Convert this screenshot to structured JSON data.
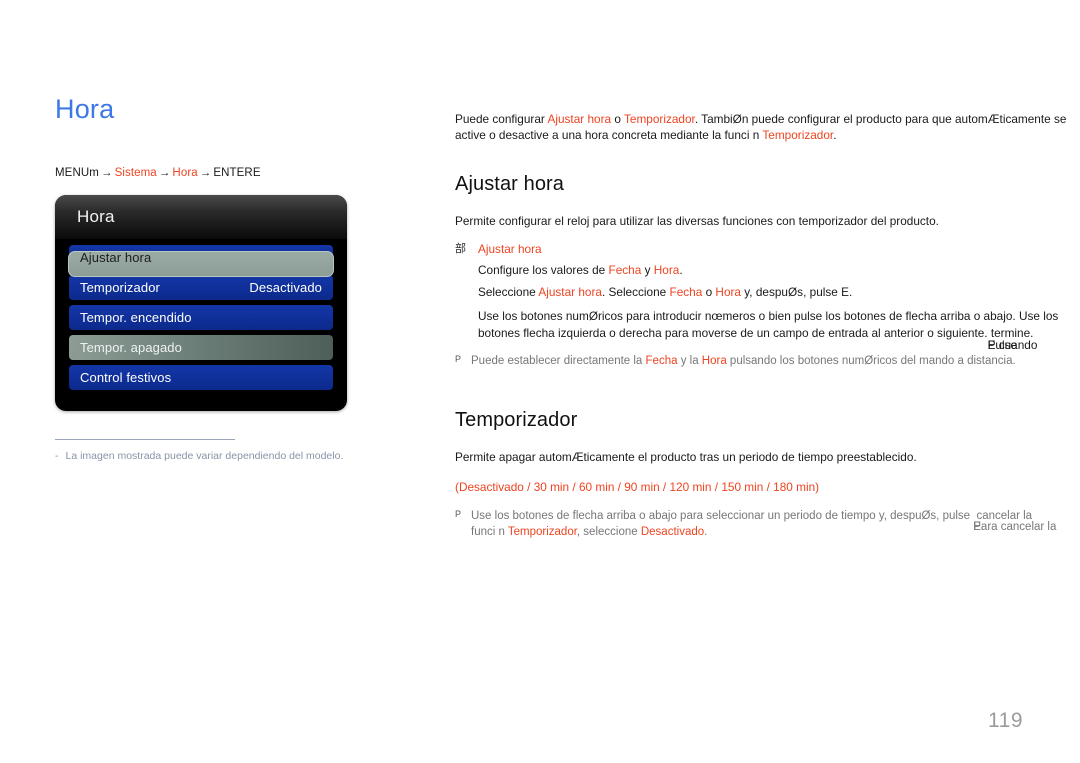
{
  "page": {
    "title": "Hora",
    "number": "119"
  },
  "breadcrumb": {
    "start": "MENUm",
    "arrow": "→",
    "item1": "Sistema",
    "item2": "Hora",
    "end": "ENTERE"
  },
  "osd": {
    "header_title": "Hora",
    "items": [
      {
        "label": "Ajustar hora",
        "value": "",
        "state": "selected"
      },
      {
        "label": "Temporizador",
        "value": "Desactivado",
        "state": "normal"
      },
      {
        "label": "Tempor. encendido",
        "value": "",
        "state": "normal"
      },
      {
        "label": "Tempor. apagado",
        "value": "",
        "state": "dim"
      },
      {
        "label": "Control festivos",
        "value": "",
        "state": "normal"
      }
    ]
  },
  "footnote": {
    "dash": "-",
    "text": "La imagen mostrada puede variar dependiendo del modelo."
  },
  "intro": {
    "p1_a": "Puede configurar ",
    "p1_link1": "Ajustar hora",
    "p1_b": " o ",
    "p1_link2": "Temporizador",
    "p1_c": ". TambiØn puede configurar el producto para que automÆticamente se active o desactive a una hora concreta mediante la funci n ",
    "p1_link3": "Temporizador",
    "p1_d": "."
  },
  "ajustar": {
    "heading": "Ajustar hora",
    "intro": "Permite configurar el reloj para utilizar las diversas funciones con temporizador del producto.",
    "bullet_glyph": "部",
    "bullet_title": "Ajustar hora",
    "line1_a": "Configure los valores de ",
    "line1_link1": "Fecha",
    "line1_b": " y ",
    "line1_link2": "Hora",
    "line1_c": ".",
    "line2_a": "Seleccione ",
    "line2_link1": "Ajustar hora",
    "line2_b": ". Seleccione ",
    "line2_link2": "Fecha",
    "line2_c": " o ",
    "line2_link3": "Hora",
    "line2_d": " y, despuØs, pulse E.",
    "line3": "Use los botones numØricos para introducir nœmeros o bien pulse los botones de flecha arriba o abajo. Use los botones flecha izquierda o derecha para moverse de un campo de entrada al anterior o siguiente.",
    "line3_overlap_a": "Pulse",
    "line3_overlap_b": "E cuando",
    "line3_tail": " termine.",
    "note_marker": "P",
    "note_a": "Puede establecer directamente la ",
    "note_link1": "Fecha",
    "note_b": " y la ",
    "note_link2": "Hora",
    "note_c": " pulsando los botones numØricos del mando a distancia."
  },
  "temporizador": {
    "heading": "Temporizador",
    "intro": "Permite apagar automÆticamente el producto tras un periodo de tiempo preestablecido.",
    "options_open": "(",
    "options": [
      "Desactivado",
      "30 min",
      "60 min",
      "90 min",
      "120 min",
      "150 min",
      "180 min"
    ],
    "options_sep": " / ",
    "options_close": ")",
    "note_marker": "P",
    "note_a": "Use los botones de flecha arriba o abajo para seleccionar un periodo de tiempo y, despuØs, pulse ",
    "note_overlap_a": "E.",
    "note_overlap_b": "Para cancelar la",
    "note_tail": " cancelar la",
    "note_line2_a": "funci n ",
    "note_line2_link1": "Temporizador",
    "note_line2_b": ", seleccione ",
    "note_line2_link2": "Desactivado",
    "note_line2_c": "."
  },
  "colors": {
    "accent": "#ee4422",
    "title_blue": "#3c78e6",
    "menu_blue": "#10309a",
    "menu_selected": "#93a49e",
    "note_gray": "#777777",
    "footnote_gray": "#8b93a8"
  }
}
